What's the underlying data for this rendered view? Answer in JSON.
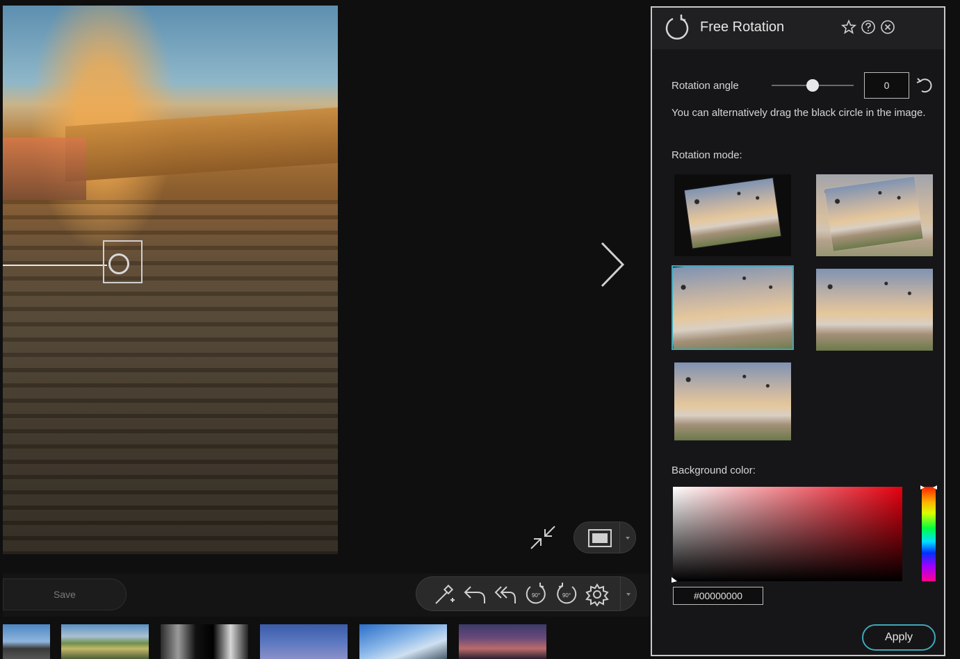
{
  "panel": {
    "title": "Free Rotation",
    "rotation_angle_label": "Rotation angle",
    "rotation_angle_value": "0",
    "slider_fraction": 0.5,
    "hint": "You can alternatively drag the black circle in the image.",
    "rotation_mode_label": "Rotation mode:",
    "rotation_modes_count": 5,
    "selected_mode_index": 2,
    "background_color_label": "Background color:",
    "background_color_value": "#00000000",
    "apply_label": "Apply",
    "accent": "#3fa8b9"
  },
  "toolbar": {
    "save_label": "Save",
    "tools": [
      "magic-wand-icon",
      "undo-icon",
      "undo-all-icon",
      "rotate-left-90-icon",
      "rotate-right-90-icon",
      "settings-icon"
    ],
    "rotate_badge": "90°"
  },
  "icons": [
    "rotate-icon",
    "star-icon",
    "help-icon",
    "close-icon",
    "reset-icon",
    "chevron-right-icon",
    "shrink-icon",
    "view-mode-icon"
  ]
}
